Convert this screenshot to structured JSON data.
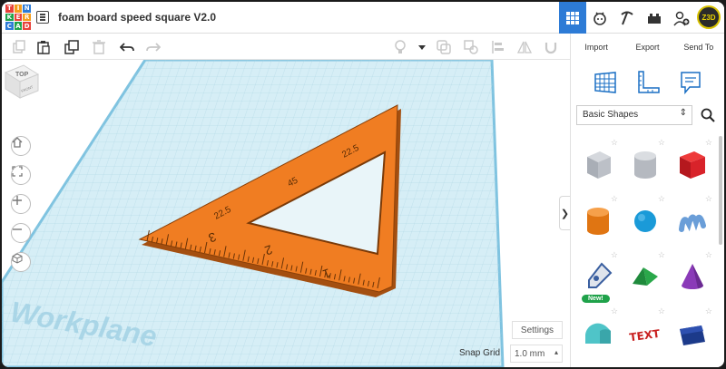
{
  "app": {
    "logo_letters": [
      "TIN",
      "KER",
      "CAD"
    ],
    "logo_cells": [
      "T",
      "I",
      "N",
      "K",
      "E",
      "R",
      "C",
      "A",
      "D"
    ],
    "logo_colors": [
      "#e8413a",
      "#f59c1a",
      "#2d7bd6",
      "#1fa24a",
      "#e8413a",
      "#f59c1a",
      "#2d7bd6",
      "#1fa24a",
      "#e8413a"
    ],
    "document_title": "foam board speed square V2.0"
  },
  "top_nav": {
    "items": [
      {
        "name": "3d-design-view",
        "icon": "grid-icon",
        "active": true
      },
      {
        "name": "circuits-view",
        "icon": "bot-icon",
        "active": false
      },
      {
        "name": "minecraft-view",
        "icon": "pickaxe-icon",
        "active": false
      },
      {
        "name": "bricks-view",
        "icon": "bricks-icon",
        "active": false
      },
      {
        "name": "add-user",
        "icon": "add-user-icon",
        "active": false
      }
    ],
    "avatar_text": "Z3D"
  },
  "toolbar": {
    "tools": [
      "copy-icon",
      "paste-icon",
      "duplicate-icon",
      "delete-icon",
      "undo-icon",
      "redo-icon",
      "light-icon",
      "dropdown-icon",
      "group-icon",
      "ungroup-icon",
      "align-icon",
      "mirror-icon",
      "magnet-icon"
    ]
  },
  "right_panel": {
    "tabs": [
      "Import",
      "Export",
      "Send To"
    ],
    "view_icons": [
      "workplane-icon",
      "ruler-icon",
      "notes-icon"
    ],
    "shape_category": "Basic Shapes",
    "shapes": [
      {
        "name": "box-hole",
        "color": "#b8bcc4"
      },
      {
        "name": "cylinder-hole",
        "color": "#c4c8ce"
      },
      {
        "name": "box",
        "color": "#d8232a"
      },
      {
        "name": "cylinder",
        "color": "#f08a1c"
      },
      {
        "name": "sphere",
        "color": "#1a9ad8"
      },
      {
        "name": "scribble",
        "color": "#6a9ed8"
      },
      {
        "name": "shape-generator",
        "color": "#3a5fa0",
        "badge": "New!"
      },
      {
        "name": "roof",
        "color": "#2aa84a"
      },
      {
        "name": "cone",
        "color": "#8a3ab8"
      },
      {
        "name": "round-roof",
        "color": "#4fc4c8"
      },
      {
        "name": "text",
        "color": "#c82020",
        "label": "TEXT"
      },
      {
        "name": "wedge",
        "color": "#1c3a8a"
      }
    ]
  },
  "viewport": {
    "workplane_label": "Workplane",
    "navcube_top": "TOP",
    "navcube_front": "FRONT",
    "square_marks": {
      "angle_labels": [
        "22.5",
        "45",
        "22.5"
      ],
      "scale_numbers": [
        "3",
        "2",
        "1"
      ]
    },
    "settings_label": "Settings",
    "snap_grid_label": "Snap Grid",
    "snap_grid_value": "1.0 mm"
  },
  "colors": {
    "accent": "#2d7bd6",
    "workplane": "#cfe8f0",
    "part": "#f07d22"
  }
}
